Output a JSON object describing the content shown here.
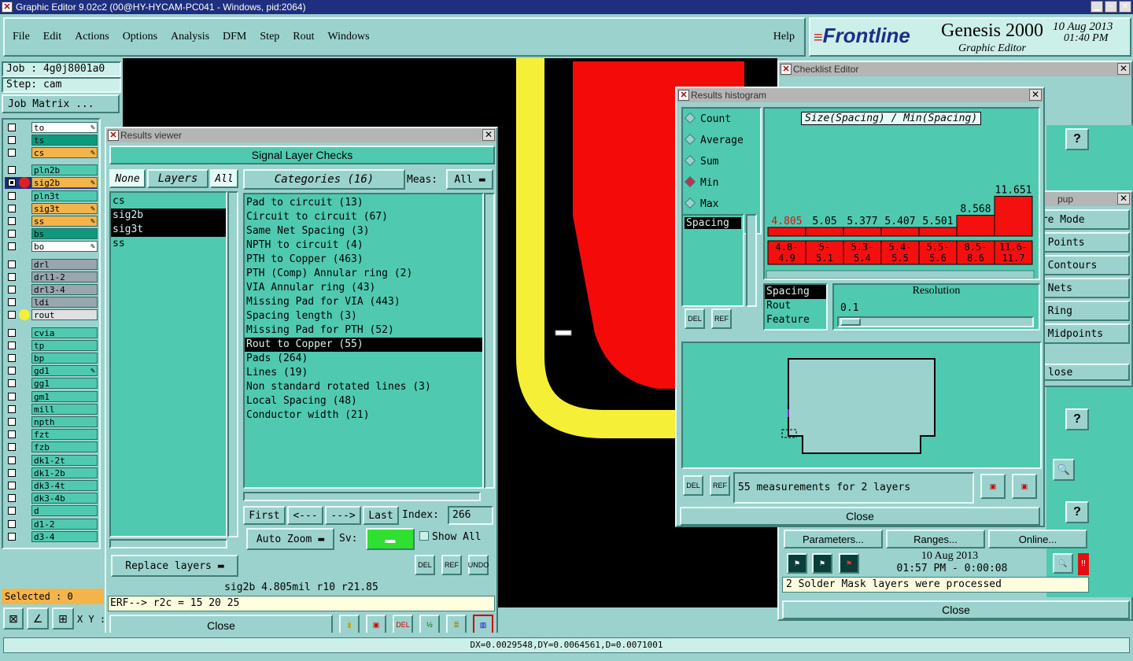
{
  "window": {
    "title": "Graphic Editor 9.02c2 (00@HY-HYCAM-PC041 - Windows, pid:2064)"
  },
  "menu": [
    "File",
    "Edit",
    "Actions",
    "Options",
    "Analysis",
    "DFM",
    "Step",
    "Rout",
    "Windows"
  ],
  "help": "Help",
  "brand": {
    "logo": "Frontline",
    "product": "Genesis 2000",
    "sub": "Graphic Editor",
    "date": "10 Aug 2013",
    "time": "01:40 PM"
  },
  "job": {
    "job": "Job : 4g0j8001a0",
    "step": "Step: cam",
    "matrix": "Job Matrix ..."
  },
  "layers": [
    {
      "name": "to",
      "color": "#ffffff",
      "mark": "✎"
    },
    {
      "name": "ts",
      "color": "#0b9a7e",
      "mark": ""
    },
    {
      "name": "cs",
      "color": "#f5b44a",
      "mark": "✎"
    },
    {
      "name": "pln2b",
      "color": "#4fcab0",
      "mark": ""
    },
    {
      "name": "sig2b",
      "color": "#f5b44a",
      "mark": "✎"
    },
    {
      "name": "pln3t",
      "color": "#4fcab0",
      "mark": ""
    },
    {
      "name": "sig3t",
      "color": "#f5b44a",
      "mark": "✎"
    },
    {
      "name": "ss",
      "color": "#f5b44a",
      "mark": "✎"
    },
    {
      "name": "bs",
      "color": "#0b9a7e",
      "mark": ""
    },
    {
      "name": "bo",
      "color": "#ffffff",
      "mark": "✎"
    },
    {
      "name": "drl",
      "color": "#9aa6ae",
      "mark": ""
    },
    {
      "name": "drl1-2",
      "color": "#9aa6ae",
      "mark": ""
    },
    {
      "name": "drl3-4",
      "color": "#9aa6ae",
      "mark": ""
    },
    {
      "name": "ldi",
      "color": "#9aa6ae",
      "mark": ""
    },
    {
      "name": "rout",
      "color": "#e0e0e0",
      "mark": ""
    },
    {
      "name": "cvia",
      "color": "#4fcab0",
      "mark": ""
    },
    {
      "name": "tp",
      "color": "#4fcab0",
      "mark": ""
    },
    {
      "name": "bp",
      "color": "#4fcab0",
      "mark": ""
    },
    {
      "name": "gd1",
      "color": "#4fcab0",
      "mark": "✎"
    },
    {
      "name": "gg1",
      "color": "#4fcab0",
      "mark": ""
    },
    {
      "name": "gm1",
      "color": "#4fcab0",
      "mark": ""
    },
    {
      "name": "mill",
      "color": "#4fcab0",
      "mark": ""
    },
    {
      "name": "npth",
      "color": "#4fcab0",
      "mark": ""
    },
    {
      "name": "fzt",
      "color": "#4fcab0",
      "mark": ""
    },
    {
      "name": "fzb",
      "color": "#4fcab0",
      "mark": ""
    },
    {
      "name": "dk1-2t",
      "color": "#4fcab0",
      "mark": ""
    },
    {
      "name": "dk1-2b",
      "color": "#4fcab0",
      "mark": ""
    },
    {
      "name": "dk3-4t",
      "color": "#4fcab0",
      "mark": ""
    },
    {
      "name": "dk3-4b",
      "color": "#4fcab0",
      "mark": ""
    },
    {
      "name": "d",
      "color": "#4fcab0",
      "mark": ""
    },
    {
      "name": "d1-2",
      "color": "#4fcab0",
      "mark": ""
    },
    {
      "name": "d3-4",
      "color": "#4fcab0",
      "mark": ""
    }
  ],
  "selected": "Selected : 0",
  "xy": "X Y :",
  "status": "DX=0.0029548,DY=0.0064561,D=0.0071001",
  "rv": {
    "title": "Results viewer",
    "header": "Signal Layer Checks",
    "none": "None",
    "layers": "Layers",
    "all": "All",
    "categories_btn": "Categories (16)",
    "meas": "Meas:",
    "meas_val": "All",
    "layer_list": [
      "cs",
      "sig2b",
      "sig3t",
      "ss"
    ],
    "categories": [
      "Pad to circuit (13)",
      "Circuit to circuit (67)",
      "Same Net Spacing (3)",
      "NPTH to circuit (4)",
      "PTH to Copper (463)",
      "PTH (Comp) Annular ring (2)",
      "VIA Annular ring (43)",
      "Missing Pad for VIA (443)",
      "Spacing length (3)",
      "Missing Pad for PTH (52)",
      "Rout to Copper (55)",
      "Pads (264)",
      "Lines (19)",
      "Non standard rotated lines (3)",
      "Local Spacing (48)",
      "Conductor width (21)"
    ],
    "first": "First",
    "prev": "<---",
    "next": "--->",
    "last": "Last",
    "index_label": "Index:",
    "index_val": "266",
    "auto_zoom": "Auto Zoom",
    "sv": "Sv:",
    "show_all": "Show All",
    "replace": "Replace layers",
    "info": "sig2b 4.805mil   r10   r21.85",
    "erf": "ERF--> r2c = 15 20 25",
    "close": "Close"
  },
  "hist": {
    "title": "Results histogram",
    "chart_title": "Size(Spacing) / Min(Spacing)",
    "modes": [
      "Count",
      "Average",
      "Sum",
      "Min",
      "Max"
    ],
    "mode_selected": "Min",
    "measure": "Spacing",
    "params": [
      "Spacing",
      "Rout",
      "Feature"
    ],
    "resolution": "Resolution",
    "res_val": "0.1",
    "measurements": "55 measurements for 2 layers",
    "close": "Close"
  },
  "chart_data": {
    "type": "bar",
    "title": "Size(Spacing) / Min(Spacing)",
    "categories": [
      "4.8-4.9",
      "5-5.1",
      "5.3-5.4",
      "5.4-5.5",
      "5.5-5.6",
      "8.5-8.6",
      "11.6-11.7"
    ],
    "values": [
      4.805,
      5.05,
      5.377,
      5.407,
      5.501,
      8.568,
      11.651
    ],
    "labels": [
      "4.805",
      "5.05",
      "5.377",
      "5.407",
      "5.501",
      "8.568",
      "11.651"
    ],
    "bar_heights": [
      0.5,
      0.5,
      0.5,
      0.5,
      0.5,
      1.2,
      2.3
    ]
  },
  "checklist": {
    "title": "Checklist Editor",
    "parameters": "Parameters...",
    "ranges": "Ranges...",
    "online": "Online...",
    "date": "10 Aug 2013",
    "time": "01:57 PM - 0:00:08",
    "msg": "2 Solder Mask layers were processed",
    "close": "Close",
    "popup_title": "pup",
    "popup_items": [
      "ure Mode",
      "n Points",
      "n Contours",
      "n Nets",
      "r Ring",
      "n Midpoints"
    ],
    "popup_close": "lose"
  }
}
